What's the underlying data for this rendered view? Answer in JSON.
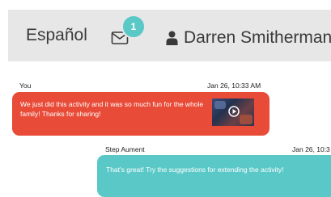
{
  "header": {
    "language": "Español",
    "notification_count": "1",
    "user_name": "Darren Smitherman",
    "icons": {
      "mail": "envelope-icon",
      "user": "person-icon",
      "menu": "chevron-down-icon"
    }
  },
  "messages": [
    {
      "sender": "You",
      "time": "Jan 26, 10:33 AM",
      "text": "We just did this activity and it was so much fun for the whole family! Thanks for sharing!",
      "has_video": true,
      "color": "#e84b38"
    },
    {
      "sender": "Step Aument",
      "time": "Jan 26, 10:3",
      "text": "That's great! Try the suggestions for extending the activity!",
      "color": "#5bc8c8"
    }
  ],
  "colors": {
    "header_bg": "#e7e7e7",
    "accent": "#5bc8c8",
    "sent_bubble": "#e84b38"
  }
}
